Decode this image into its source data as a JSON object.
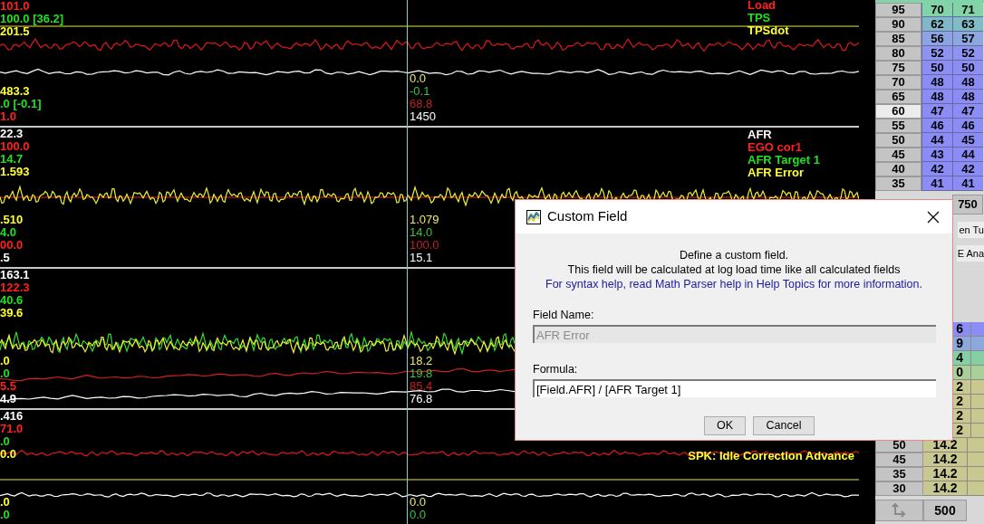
{
  "log_panels": [
    {
      "max_labels": [
        {
          "text": "101.0",
          "color": "#ff2020"
        },
        {
          "text": "100.0 [36.2]",
          "color": "#20e020"
        },
        {
          "text": "201.5",
          "color": "#ffff30"
        }
      ],
      "channel_names": [
        {
          "text": "Load",
          "color": "#ff2020"
        },
        {
          "text": "TPS",
          "color": "#20e020"
        },
        {
          "text": "TPSdot",
          "color": "#ffff30"
        }
      ],
      "min_labels": [
        {
          "text": "483.3",
          "color": "#ffff30"
        },
        {
          "text": ".0 [-0.1]",
          "color": "#20e020"
        },
        {
          "text": "1.0",
          "color": "#ff2020"
        }
      ],
      "cursor_values": [
        {
          "text": "0.0",
          "color": "#e8e870"
        },
        {
          "text": "-0.1",
          "color": "#40c040"
        },
        {
          "text": "68.8",
          "color": "#c02020"
        },
        {
          "text": "1450",
          "color": "#ffffff"
        }
      ]
    },
    {
      "max_labels": [
        {
          "text": "22.3",
          "color": "#ffffff"
        },
        {
          "text": "100.0",
          "color": "#ff2020"
        },
        {
          "text": "14.7",
          "color": "#20e020"
        },
        {
          "text": "1.593",
          "color": "#ffff30"
        }
      ],
      "channel_names": [
        {
          "text": "AFR",
          "color": "#ffffff"
        },
        {
          "text": "EGO cor1",
          "color": "#ff2020"
        },
        {
          "text": "AFR Target 1",
          "color": "#20e020"
        },
        {
          "text": "AFR Error",
          "color": "#ffff30"
        }
      ],
      "min_labels": [
        {
          "text": ".510",
          "color": "#ffff30"
        },
        {
          "text": "4.0",
          "color": "#20e020"
        },
        {
          "text": "00.0",
          "color": "#ff2020"
        },
        {
          "text": ".5",
          "color": "#ffffff"
        }
      ],
      "cursor_values": [
        {
          "text": "1.079",
          "color": "#e8e870"
        },
        {
          "text": "14.0",
          "color": "#40c040"
        },
        {
          "text": "100.0",
          "color": "#c02020"
        },
        {
          "text": "15.1",
          "color": "#ffffff"
        }
      ]
    },
    {
      "max_labels": [
        {
          "text": "163.1",
          "color": "#ffffff"
        },
        {
          "text": "122.3",
          "color": "#ff2020"
        },
        {
          "text": "40.6",
          "color": "#20e020"
        },
        {
          "text": "39.6",
          "color": "#ffff30"
        }
      ],
      "min_labels": [
        {
          "text": ".0",
          "color": "#ffff30"
        },
        {
          "text": ".0",
          "color": "#20e020"
        },
        {
          "text": "5.5",
          "color": "#ff2020"
        },
        {
          "text": "4.9",
          "color": "#ffffff"
        }
      ],
      "cursor_values": [
        {
          "text": "18.2",
          "color": "#e8e870"
        },
        {
          "text": "19.8",
          "color": "#40c040"
        },
        {
          "text": "85.4",
          "color": "#c02020"
        },
        {
          "text": "76.8",
          "color": "#ffffff"
        }
      ]
    },
    {
      "max_labels": [
        {
          "text": ".416",
          "color": "#ffffff"
        },
        {
          "text": "71.0",
          "color": "#ff2020"
        },
        {
          "text": ".0",
          "color": "#20e020"
        },
        {
          "text": "0.0",
          "color": "#ffff30"
        }
      ],
      "channel_names": [
        {
          "text": "SPK: Idle Correction Advance",
          "color": "#ffff30"
        }
      ],
      "min_labels": [
        {
          "text": ".0",
          "color": "#ffff30"
        },
        {
          "text": ".0",
          "color": "#20e020"
        }
      ],
      "cursor_values": [
        {
          "text": "0.0",
          "color": "#e8e870"
        },
        {
          "text": "0.0",
          "color": "#40c040"
        }
      ]
    }
  ],
  "ve_table": {
    "rows": [
      {
        "label": "95",
        "selected": false,
        "cells": [
          {
            "text": "70",
            "color": "#80d4a8"
          },
          {
            "text": "71",
            "color": "#80d4a8"
          }
        ]
      },
      {
        "label": "90",
        "selected": false,
        "cells": [
          {
            "text": "62",
            "color": "#80b8c8"
          },
          {
            "text": "63",
            "color": "#80bcc4"
          }
        ]
      },
      {
        "label": "85",
        "selected": false,
        "cells": [
          {
            "text": "56",
            "color": "#8ca4e4"
          },
          {
            "text": "57",
            "color": "#8ca8e0"
          }
        ]
      },
      {
        "label": "80",
        "selected": false,
        "cells": [
          {
            "text": "52",
            "color": "#8c94f0"
          },
          {
            "text": "52",
            "color": "#8c94f0"
          }
        ]
      },
      {
        "label": "75",
        "selected": false,
        "cells": [
          {
            "text": "50",
            "color": "#8c8ef4"
          },
          {
            "text": "50",
            "color": "#8c8ef4"
          }
        ]
      },
      {
        "label": "70",
        "selected": false,
        "cells": [
          {
            "text": "48",
            "color": "#8c8cf6"
          },
          {
            "text": "48",
            "color": "#8c8cf6"
          }
        ]
      },
      {
        "label": "65",
        "selected": false,
        "cells": [
          {
            "text": "48",
            "color": "#8c8cf6"
          },
          {
            "text": "48",
            "color": "#8c8cf6"
          }
        ]
      },
      {
        "label": "60",
        "selected": true,
        "cells": [
          {
            "text": "47",
            "color": "#8c8cf6"
          },
          {
            "text": "47",
            "color": "#8c8cf6"
          }
        ]
      },
      {
        "label": "55",
        "selected": false,
        "cells": [
          {
            "text": "46",
            "color": "#8c8cf6"
          },
          {
            "text": "46",
            "color": "#8c8cf6"
          }
        ]
      },
      {
        "label": "50",
        "selected": false,
        "cells": [
          {
            "text": "44",
            "color": "#8c8cf8"
          },
          {
            "text": "45",
            "color": "#8c8cf6"
          }
        ]
      },
      {
        "label": "45",
        "selected": false,
        "cells": [
          {
            "text": "43",
            "color": "#8c8cf8"
          },
          {
            "text": "44",
            "color": "#8c8cf8"
          }
        ]
      },
      {
        "label": "40",
        "selected": false,
        "cells": [
          {
            "text": "42",
            "color": "#8c8cf8"
          },
          {
            "text": "42",
            "color": "#8c8cf8"
          }
        ]
      },
      {
        "label": "35",
        "selected": false,
        "cells": [
          {
            "text": "41",
            "color": "#8c8cf8"
          },
          {
            "text": "41",
            "color": "#8c8cf8"
          }
        ]
      }
    ],
    "axis_value": "750"
  },
  "tabs": [
    {
      "label": "en Tu"
    },
    {
      "label": "E Ana"
    }
  ],
  "afr_table": {
    "partial_cells": [
      {
        "text": "6",
        "color": "#8c8cf6"
      },
      {
        "text": "9",
        "color": "#8ca8dc"
      },
      {
        "text": "4",
        "color": "#84d0a4"
      },
      {
        "text": "0",
        "color": "#a8d098"
      },
      {
        "text": "2",
        "color": "#c8c890"
      },
      {
        "text": "2",
        "color": "#c8c890"
      },
      {
        "text": "2",
        "color": "#c8c890"
      },
      {
        "text": "2",
        "color": "#c8c890"
      }
    ],
    "rows": [
      {
        "label": "50",
        "value": "14.2",
        "color": "#c8c890"
      },
      {
        "label": "45",
        "value": "14.2",
        "color": "#c8c890"
      },
      {
        "label": "35",
        "value": "14.2",
        "color": "#c8c890"
      },
      {
        "label": "30",
        "value": "14.2",
        "color": "#c8c890"
      }
    ],
    "axis_value": "500"
  },
  "dialog": {
    "title": "Custom Field",
    "lines": [
      "Define a custom field.",
      "This field will be calculated at log load time like all calculated fields"
    ],
    "link": "For syntax help, read Math Parser help in Help Topics for more information.",
    "field_name": {
      "label": "Field Name:",
      "value": "AFR Error",
      "disabled": true
    },
    "formula": {
      "label": "Formula:",
      "value": "[Field.AFR] / [AFR Target 1]",
      "disabled": false
    },
    "buttons": [
      "OK",
      "Cancel"
    ]
  }
}
